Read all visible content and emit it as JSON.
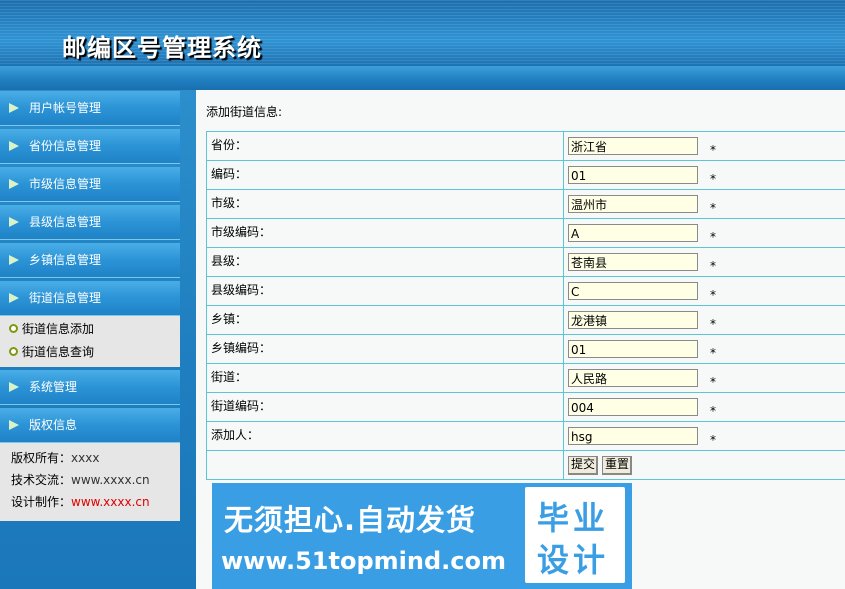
{
  "header": {
    "title": "邮编区号管理系统"
  },
  "sidebar": {
    "items": [
      {
        "label": "用户帐号管理"
      },
      {
        "label": "省份信息管理"
      },
      {
        "label": "市级信息管理"
      },
      {
        "label": "县级信息管理"
      },
      {
        "label": "乡镇信息管理"
      },
      {
        "label": "街道信息管理"
      },
      {
        "label": "系统管理"
      },
      {
        "label": "版权信息"
      }
    ],
    "street_sub": [
      {
        "label": "街道信息添加"
      },
      {
        "label": "街道信息查询"
      }
    ],
    "info": {
      "copyright_label": "版权所有：",
      "copyright_value": "xxxx",
      "tech_label": "技术交流：",
      "tech_value": "www.xxxx.cn",
      "design_label": "设计制作：",
      "design_value": "www.xxxx.cn"
    }
  },
  "main": {
    "breadcrumb": "添加街道信息:",
    "rows": [
      {
        "label": "省份：",
        "value": "浙江省"
      },
      {
        "label": "编码：",
        "value": "01"
      },
      {
        "label": "市级：",
        "value": "温州市"
      },
      {
        "label": "市级编码：",
        "value": "A"
      },
      {
        "label": "县级：",
        "value": "苍南县"
      },
      {
        "label": "县级编码：",
        "value": "C"
      },
      {
        "label": "乡镇：",
        "value": "龙港镇"
      },
      {
        "label": "乡镇编码：",
        "value": "01"
      },
      {
        "label": "街道：",
        "value": "人民路"
      },
      {
        "label": "街道编码：",
        "value": "004"
      },
      {
        "label": "添加人：",
        "value": "hsg"
      }
    ],
    "required_mark": "*",
    "submit_label": "提交",
    "reset_label": "重置"
  },
  "watermark": {
    "line1": "无须担心.自动发货",
    "line2": "www.51topmind.com",
    "badge_top": "毕业",
    "badge_bottom": "设计"
  },
  "colors": {
    "header_blue": "#1d6fae",
    "menu_blue": "#2b93d6",
    "table_border": "#5cc6d6",
    "input_bg": "#ffffe6",
    "info_red": "#e00000",
    "watermark_blue": "#3a9ee4"
  }
}
